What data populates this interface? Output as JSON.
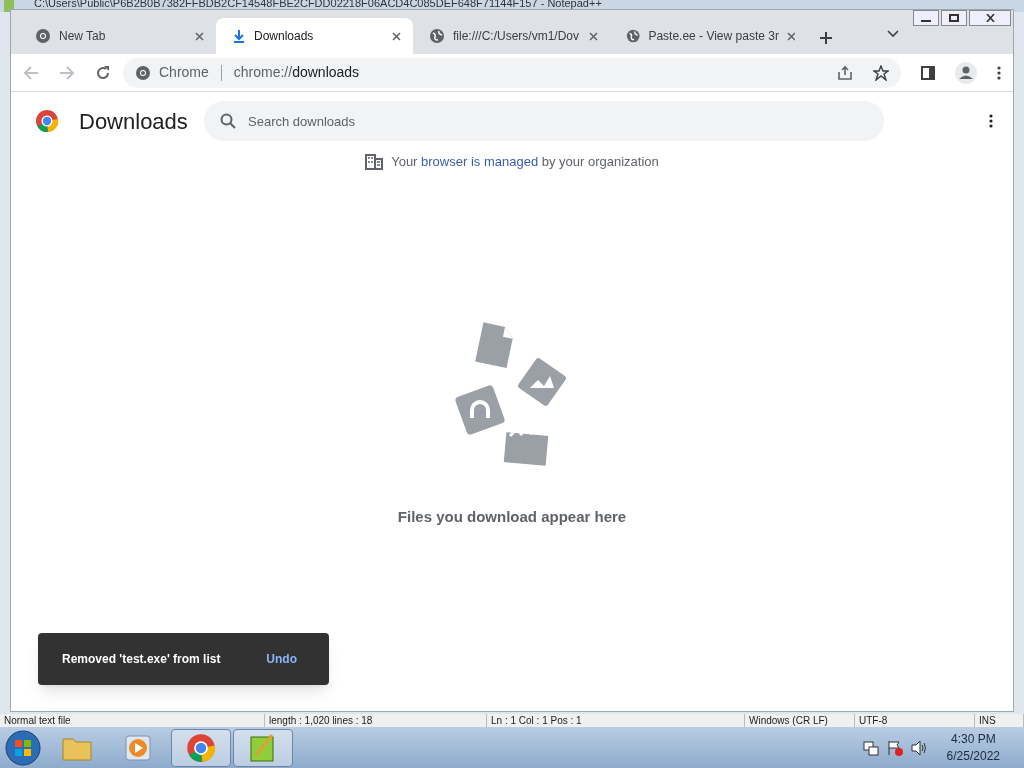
{
  "background_window": {
    "title": "C:\\Users\\Public\\P6B2B0B7382FFBDB2CF14548FBE2CFDD02218F06ACD4C085DEF648F71144F157 - Notepad++",
    "status_bar": [
      "Normal text file",
      "length : 1,020    lines : 18",
      "Ln : 1    Col : 1    Pos : 1",
      "Windows (CR LF)",
      "UTF-8",
      "INS"
    ]
  },
  "tabs": [
    {
      "label": "New Tab",
      "kind": "chrome",
      "selected": false
    },
    {
      "label": "Downloads",
      "kind": "download",
      "selected": true
    },
    {
      "label": "file:///C:/Users/vm1/Dov",
      "kind": "globe",
      "selected": false
    },
    {
      "label": "Paste.ee - View paste 3r",
      "kind": "globe",
      "selected": false
    }
  ],
  "address_bar": {
    "site_label": "Chrome",
    "url_host": "chrome://",
    "url_path": "downloads"
  },
  "page": {
    "title": "Downloads",
    "search": {
      "placeholder": "Search downloads"
    },
    "managed_link_before": "Your ",
    "managed_link": "browser is managed",
    "managed_link_after": " by your organization",
    "empty_message": "Files you download appear here"
  },
  "toast": {
    "message": "Removed 'test.exe' from list",
    "action": "Undo"
  },
  "taskbar": {
    "apps": [
      {
        "kind": "start",
        "selected": false
      },
      {
        "kind": "explorer",
        "selected": false
      },
      {
        "kind": "media",
        "selected": false
      },
      {
        "kind": "chrome",
        "selected": true
      },
      {
        "kind": "notepad",
        "selected": true
      }
    ],
    "time": "4:30 PM",
    "date": "6/25/2022"
  }
}
